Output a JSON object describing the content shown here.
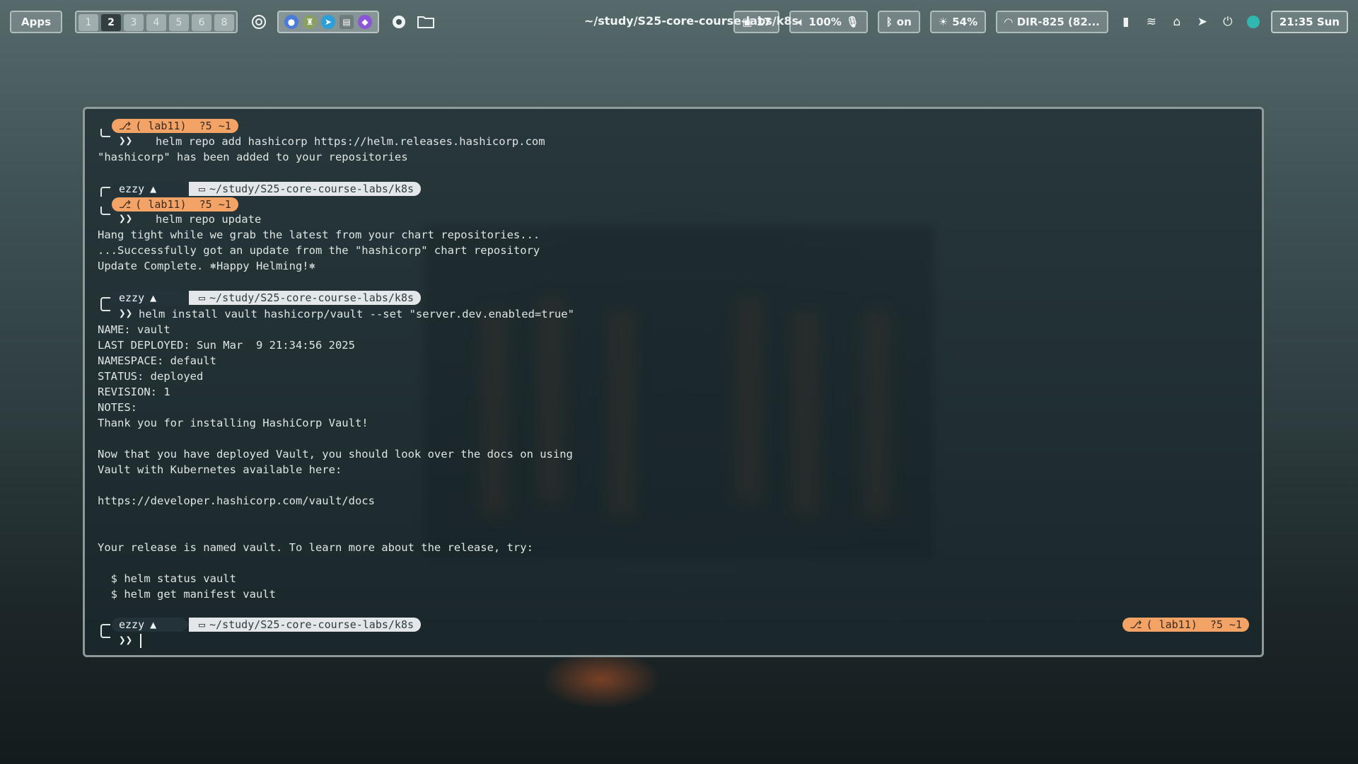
{
  "topbar": {
    "apps_label": "Apps",
    "workspaces": [
      "1",
      "2",
      "3",
      "4",
      "5",
      "6",
      "8"
    ],
    "active_workspace": "2",
    "window_title": "~/study/S25-core-course-labs/k8s",
    "packages_count": "17",
    "volume": "100%",
    "bluetooth": "on",
    "brightness": "54%",
    "wifi": "DIR-825 (82...",
    "clock": "21:35 Sun"
  },
  "prompt": {
    "user": "ezzy",
    "dir": "~/study/S25-core-course-labs/k8s",
    "git": "( lab11)  ?5 ~1",
    "chevron": "❯❯"
  },
  "terminal": {
    "cmd1": "   helm repo add hashicorp https://helm.releases.hashicorp.com",
    "out1": "\"hashicorp\" has been added to your repositories",
    "cmd2": "   helm repo update",
    "out2": [
      "Hang tight while we grab the latest from your chart repositories...",
      "...Successfully got an update from the \"hashicorp\" chart repository",
      "Update Complete. ⎈Happy Helming!⎈"
    ],
    "cmd3": "helm install vault hashicorp/vault --set \"server.dev.enabled=true\"",
    "out3": [
      "NAME: vault",
      "LAST DEPLOYED: Sun Mar  9 21:34:56 2025",
      "NAMESPACE: default",
      "STATUS: deployed",
      "REVISION: 1",
      "NOTES:",
      "Thank you for installing HashiCorp Vault!",
      "",
      "Now that you have deployed Vault, you should look over the docs on using",
      "Vault with Kubernetes available here:",
      "",
      "https://developer.hashicorp.com/vault/docs",
      "",
      "",
      "Your release is named vault. To learn more about the release, try:",
      "",
      "  $ helm status vault",
      "  $ helm get manifest vault"
    ]
  },
  "colors": {
    "git_pill": "#f2a365",
    "user_segment": "#24323a",
    "dir_segment": "#e3e7e9"
  }
}
